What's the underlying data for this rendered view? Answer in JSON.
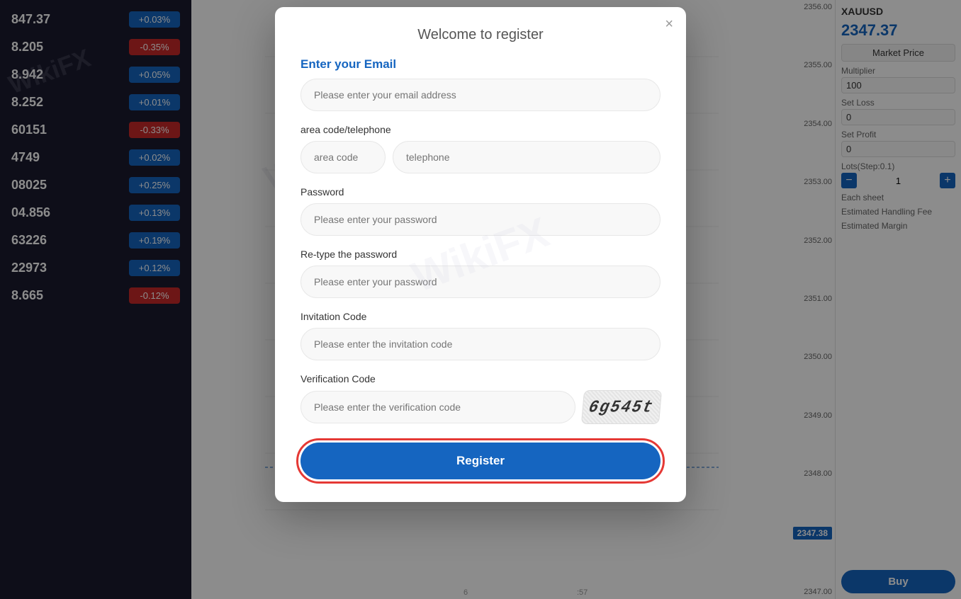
{
  "modal": {
    "title": "Welcome to register",
    "close_label": "×",
    "email_section_label": "Enter your Email",
    "email_placeholder": "Please enter your email address",
    "phone_section_label": "area code/telephone",
    "area_code_placeholder": "area code",
    "telephone_placeholder": "telephone",
    "password_label": "Password",
    "password_placeholder": "Please enter your password",
    "retype_label": "Re-type the password",
    "retype_placeholder": "Please enter your password",
    "invitation_label": "Invitation Code",
    "invitation_placeholder": "Please enter the invitation code",
    "verification_label": "Verification Code",
    "verification_placeholder": "Please enter the verification code",
    "captcha_text": "6g545t",
    "register_btn": "Register"
  },
  "sidebar": {
    "rows": [
      {
        "price": "847.37",
        "badge": "+0.03%",
        "type": "green"
      },
      {
        "price": "8.205",
        "badge": "-0.35%",
        "type": "red"
      },
      {
        "price": "8.942",
        "badge": "+0.05%",
        "type": "green"
      },
      {
        "price": "8.252",
        "badge": "+0.01%",
        "type": "green"
      },
      {
        "price": "60151",
        "badge": "-0.33%",
        "type": "red"
      },
      {
        "price": "4749",
        "badge": "+0.02%",
        "type": "green"
      },
      {
        "price": "08025",
        "badge": "+0.25%",
        "type": "green"
      },
      {
        "price": "04.856",
        "badge": "+0.13%",
        "type": "green"
      },
      {
        "price": "63226",
        "badge": "+0.19%",
        "type": "green"
      },
      {
        "price": "22973",
        "badge": "+0.12%",
        "type": "green"
      },
      {
        "price": "8.665",
        "badge": "-0.12%",
        "type": "red"
      }
    ]
  },
  "right_panel": {
    "symbol": "XAUUSD",
    "price": "2347.37",
    "market_price_label": "Market Price",
    "multiplier_label": "Multiplier",
    "multiplier_value": "100",
    "set_loss_label": "Set Loss",
    "set_loss_value": "0",
    "set_profit_label": "Set Profit",
    "set_profit_value": "0",
    "lots_label": "Lots(Step:0.1)",
    "lots_minus": "−",
    "lots_value": "1",
    "each_sheet_label": "Each sheet",
    "handling_fee_label": "Estimated Handling Fee",
    "margin_label": "Estimated Margin",
    "buy_btn": "Buy"
  },
  "chart": {
    "price_levels": [
      "2356.00",
      "2355.00",
      "2354.00",
      "2353.00",
      "2352.00",
      "2351.00",
      "2350.00",
      "2349.00",
      "2348.00",
      "2347.38",
      "2347.00"
    ],
    "time_labels": [
      "6",
      ":57"
    ],
    "current_price": "2347.38"
  },
  "watermark": {
    "wikifx_main": "WikiFX",
    "wikifx_modal": "WikiFX"
  }
}
